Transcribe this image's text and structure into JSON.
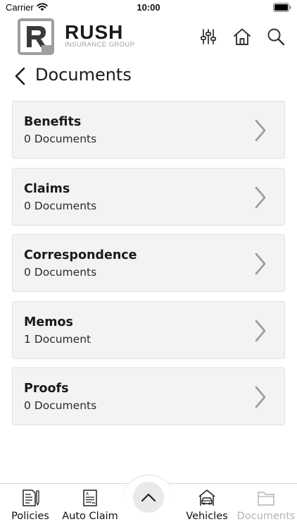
{
  "status": {
    "carrier": "Carrier",
    "time": "10:00"
  },
  "header": {
    "logo_word": "RUSH",
    "logo_sub": "INSURANCE GROUP",
    "icons": [
      "filter-sliders-icon",
      "home-icon",
      "search-icon"
    ]
  },
  "page": {
    "title": "Documents"
  },
  "documents": [
    {
      "name": "Benefits",
      "count": "0 Documents"
    },
    {
      "name": "Claims",
      "count": "0 Documents"
    },
    {
      "name": "Correspondence",
      "count": "0 Documents"
    },
    {
      "name": "Memos",
      "count": "1 Document"
    },
    {
      "name": "Proofs",
      "count": "0 Documents"
    }
  ],
  "tabs": [
    {
      "label": "Policies",
      "icon": "policy-document-icon",
      "enabled": true
    },
    {
      "label": "Auto Claim",
      "icon": "claim-form-icon",
      "enabled": true
    },
    {
      "label": "Vehicles",
      "icon": "car-garage-icon",
      "enabled": true
    },
    {
      "label": "Documents",
      "icon": "folder-icon",
      "enabled": false
    }
  ],
  "colors": {
    "card_bg": "#f3f3f3",
    "card_border": "#e0e0e0",
    "chevron": "#9a9a9a",
    "disabled_tab": "#b3b3b3",
    "logo_gray": "#a0a0a0"
  }
}
